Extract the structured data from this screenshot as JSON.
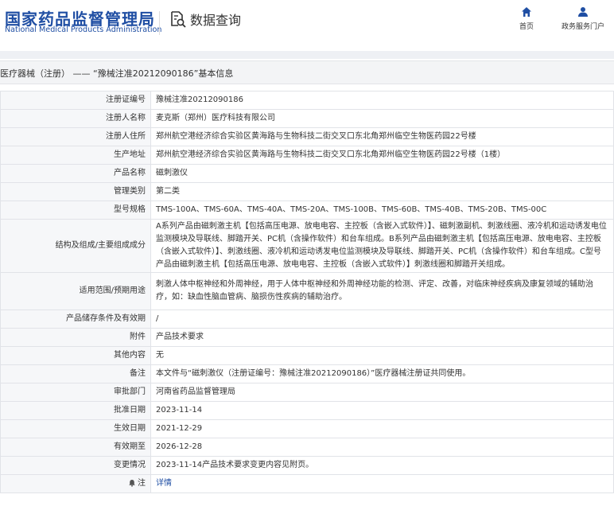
{
  "header": {
    "logo_cn": "国家药品监督管理局",
    "logo_en": "National Medical Products Administration",
    "search_label": "数据查询",
    "nav_home": "首页",
    "nav_services": "政务服务门户"
  },
  "breadcrumb": "医疗器械（注册） —— “豫械注准20212090186”基本信息",
  "rows": [
    {
      "label": "注册证编号",
      "value": "豫械注准20212090186"
    },
    {
      "label": "注册人名称",
      "value": "麦克斯（郑州）医疗科技有限公司"
    },
    {
      "label": "注册人住所",
      "value": "郑州航空港经济综合实验区黄海路与生物科技二街交叉口东北角郑州临空生物医药园22号楼"
    },
    {
      "label": "生产地址",
      "value": "郑州航空港经济综合实验区黄海路与生物科技二街交叉口东北角郑州临空生物医药园22号楼（1楼）"
    },
    {
      "label": "产品名称",
      "value": "磁刺激仪"
    },
    {
      "label": "管理类别",
      "value": "第二类"
    },
    {
      "label": "型号规格",
      "value": "TMS-100A、TMS-60A、TMS-40A、TMS-20A、TMS-100B、TMS-60B、TMS-40B、TMS-20B、TMS-00C"
    },
    {
      "label": "结构及组成/主要组成成分",
      "value": "A系列产品由磁刺激主机【包括高压电源、放电电容、主控板（含嵌入式软件）】、磁刺激副机、刺激线圈、液冷机和运动诱发电位监测模块及导联线、脚踏开关、PC机（含操作软件）和台车组成。B系列产品由磁刺激主机【包括高压电源、放电电容、主控板（含嵌入式软件）】、刺激线圈、液冷机和运动诱发电位监测模块及导联线、脚踏开关、PC机（含操作软件）和台车组成。C型号产品由磁刺激主机【包括高压电源、放电电容、主控板（含嵌入式软件）】刺激线圈和脚踏开关组成。"
    },
    {
      "label": "适用范围/预期用途",
      "value": "刺激人体中枢神经和外周神经，用于人体中枢神经和外周神经功能的检测、评定、改善，对临床神经疾病及康复领域的辅助治疗，如：缺血性脑血管病、脑损伤性疾病的辅助治疗。"
    },
    {
      "label": "产品储存条件及有效期",
      "value": "/"
    },
    {
      "label": "附件",
      "value": "产品技术要求"
    },
    {
      "label": "其他内容",
      "value": "无"
    },
    {
      "label": "备注",
      "value": "本文件与“磁刺激仪（注册证编号：豫械注准20212090186）”医疗器械注册证共同使用。"
    },
    {
      "label": "审批部门",
      "value": "河南省药品监督管理局"
    },
    {
      "label": "批准日期",
      "value": "2023-11-14"
    },
    {
      "label": "生效日期",
      "value": "2021-12-29"
    },
    {
      "label": "有效期至",
      "value": "2026-12-28"
    },
    {
      "label": "变更情况",
      "value": "2023-11-14产品技术要求变更内容见附页。"
    }
  ],
  "note": {
    "label": "注",
    "value": "详情"
  },
  "colors": {
    "brand": "#1f4ea3",
    "label_bg": "#f6f7f9",
    "border": "#e1e3e8"
  }
}
